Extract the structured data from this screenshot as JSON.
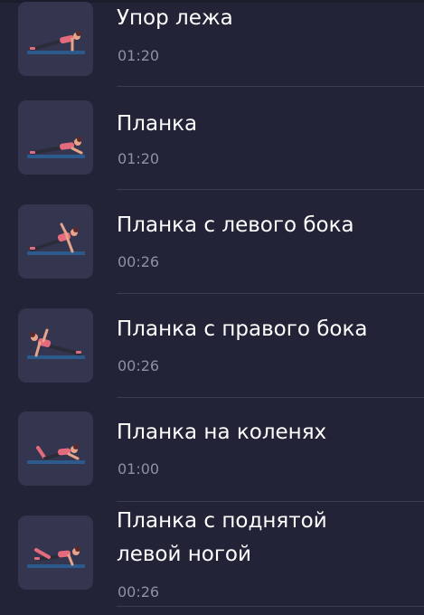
{
  "exercises": [
    {
      "title": "Упор лежа",
      "duration": "01:20",
      "icon": "plank-push-up-illustration"
    },
    {
      "title": "Планка",
      "duration": "01:20",
      "icon": "elbow-plank-illustration"
    },
    {
      "title": "Планка с левого бока",
      "duration": "00:26",
      "icon": "side-plank-left-illustration"
    },
    {
      "title": "Планка с правого бока",
      "duration": "00:26",
      "icon": "side-plank-right-illustration"
    },
    {
      "title": "Планка на коленях",
      "duration": "01:00",
      "icon": "knee-plank-illustration"
    },
    {
      "title_line1": "Планка с поднятой",
      "title_line2": "левой ногой",
      "duration": "00:26",
      "icon": "plank-leg-raise-illustration"
    }
  ],
  "colors": {
    "background": "#222336",
    "thumb": "#34364f",
    "title": "#ffffff",
    "duration": "#8e90a6",
    "separator": "#3a3c54",
    "mat": "#2d5a8c",
    "pink": "#e46b7d",
    "dark": "#2b2b3a",
    "skin": "#e8a48a"
  }
}
